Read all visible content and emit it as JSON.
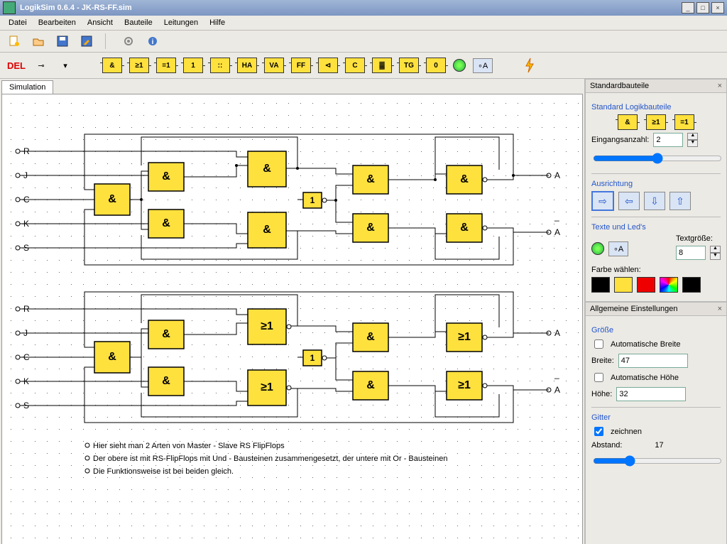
{
  "window": {
    "title": "LogikSim 0.6.4 - JK-RS-FF.sim"
  },
  "menu": [
    "Datei",
    "Bearbeiten",
    "Ansicht",
    "Bauteile",
    "Leitungen",
    "Hilfe"
  ],
  "toolbar2": {
    "del": "DEL",
    "chips": [
      "&",
      "≥1",
      "=1",
      "1",
      "::",
      "HA",
      "VA",
      "FF",
      "⊲",
      "C",
      "▓",
      "TG",
      "0"
    ],
    "zeroA": "∘A"
  },
  "tab": "Simulation",
  "labels": {
    "top": [
      "R",
      "J",
      "C",
      "K",
      "S"
    ],
    "bot": [
      "R",
      "J",
      "C",
      "K",
      "S"
    ],
    "outA": "A",
    "outAbar": "A̅"
  },
  "gateTexts": {
    "and": "&",
    "or": "≥1",
    "one": "1"
  },
  "desc": [
    "Hier sieht man 2 Arten von Master - Slave RS FlipFlops",
    "Der obere ist mit RS-FlipFlops mit Und - Bausteinen zusammengesetzt, der untere mit Or - Bausteinen",
    "Die Funktionsweise ist bei beiden gleich."
  ],
  "side": {
    "panel1": {
      "title": "Standardbauteile",
      "section1": "Standard Logikbauteile",
      "chips": [
        "&",
        "≥1",
        "=1"
      ],
      "inputsLabel": "Eingangsanzahl:",
      "inputsVal": "2",
      "section2": "Ausrichtung",
      "section3": "Texte und Led's",
      "textSize": "Textgröße:",
      "textSizeVal": "8",
      "zeroA": "∘A",
      "colorLabel": "Farbe wählen:",
      "colors": [
        "#000000",
        "#ffe13e",
        "#e00000",
        "palette",
        "#000000"
      ]
    },
    "panel2": {
      "title": "Allgemeine Einstellungen",
      "section1": "Größe",
      "autoW": "Automatische Breite",
      "widthLabel": "Breite:",
      "widthVal": "47",
      "autoH": "Automatische Höhe",
      "heightLabel": "Höhe:",
      "heightVal": "32",
      "section2": "Gitter",
      "draw": "zeichnen",
      "distLabel": "Abstand:",
      "distVal": "17"
    }
  }
}
